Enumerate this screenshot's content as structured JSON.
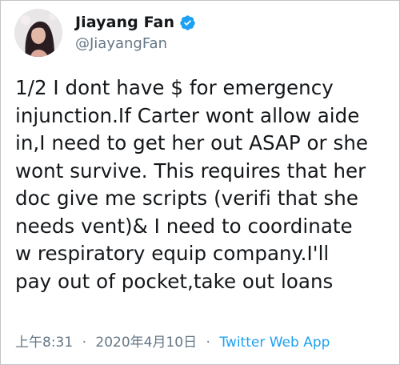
{
  "user": {
    "display_name": "Jiayang Fan",
    "handle": "@JiayangFan",
    "verified_icon": "verified-badge-icon"
  },
  "tweet": {
    "text": "1/2 I dont have $ for emergency\ninjunction.If Carter wont allow aide\nin,I need to get her out ASAP or she\nwont survive. This requires that her\ndoc give me scripts (verifi that she\nneeds vent)& I need to coordinate\nw respiratory equip company.I'll\npay out of pocket,take out loans"
  },
  "meta": {
    "time": "上午8:31",
    "separator": "·",
    "date": "2020年4月10日",
    "source": "Twitter Web App"
  },
  "colors": {
    "text": "#14171a",
    "secondary": "#657786",
    "link": "#1da1f2",
    "verified": "#1da1f2",
    "border": "#c4c4c4"
  }
}
